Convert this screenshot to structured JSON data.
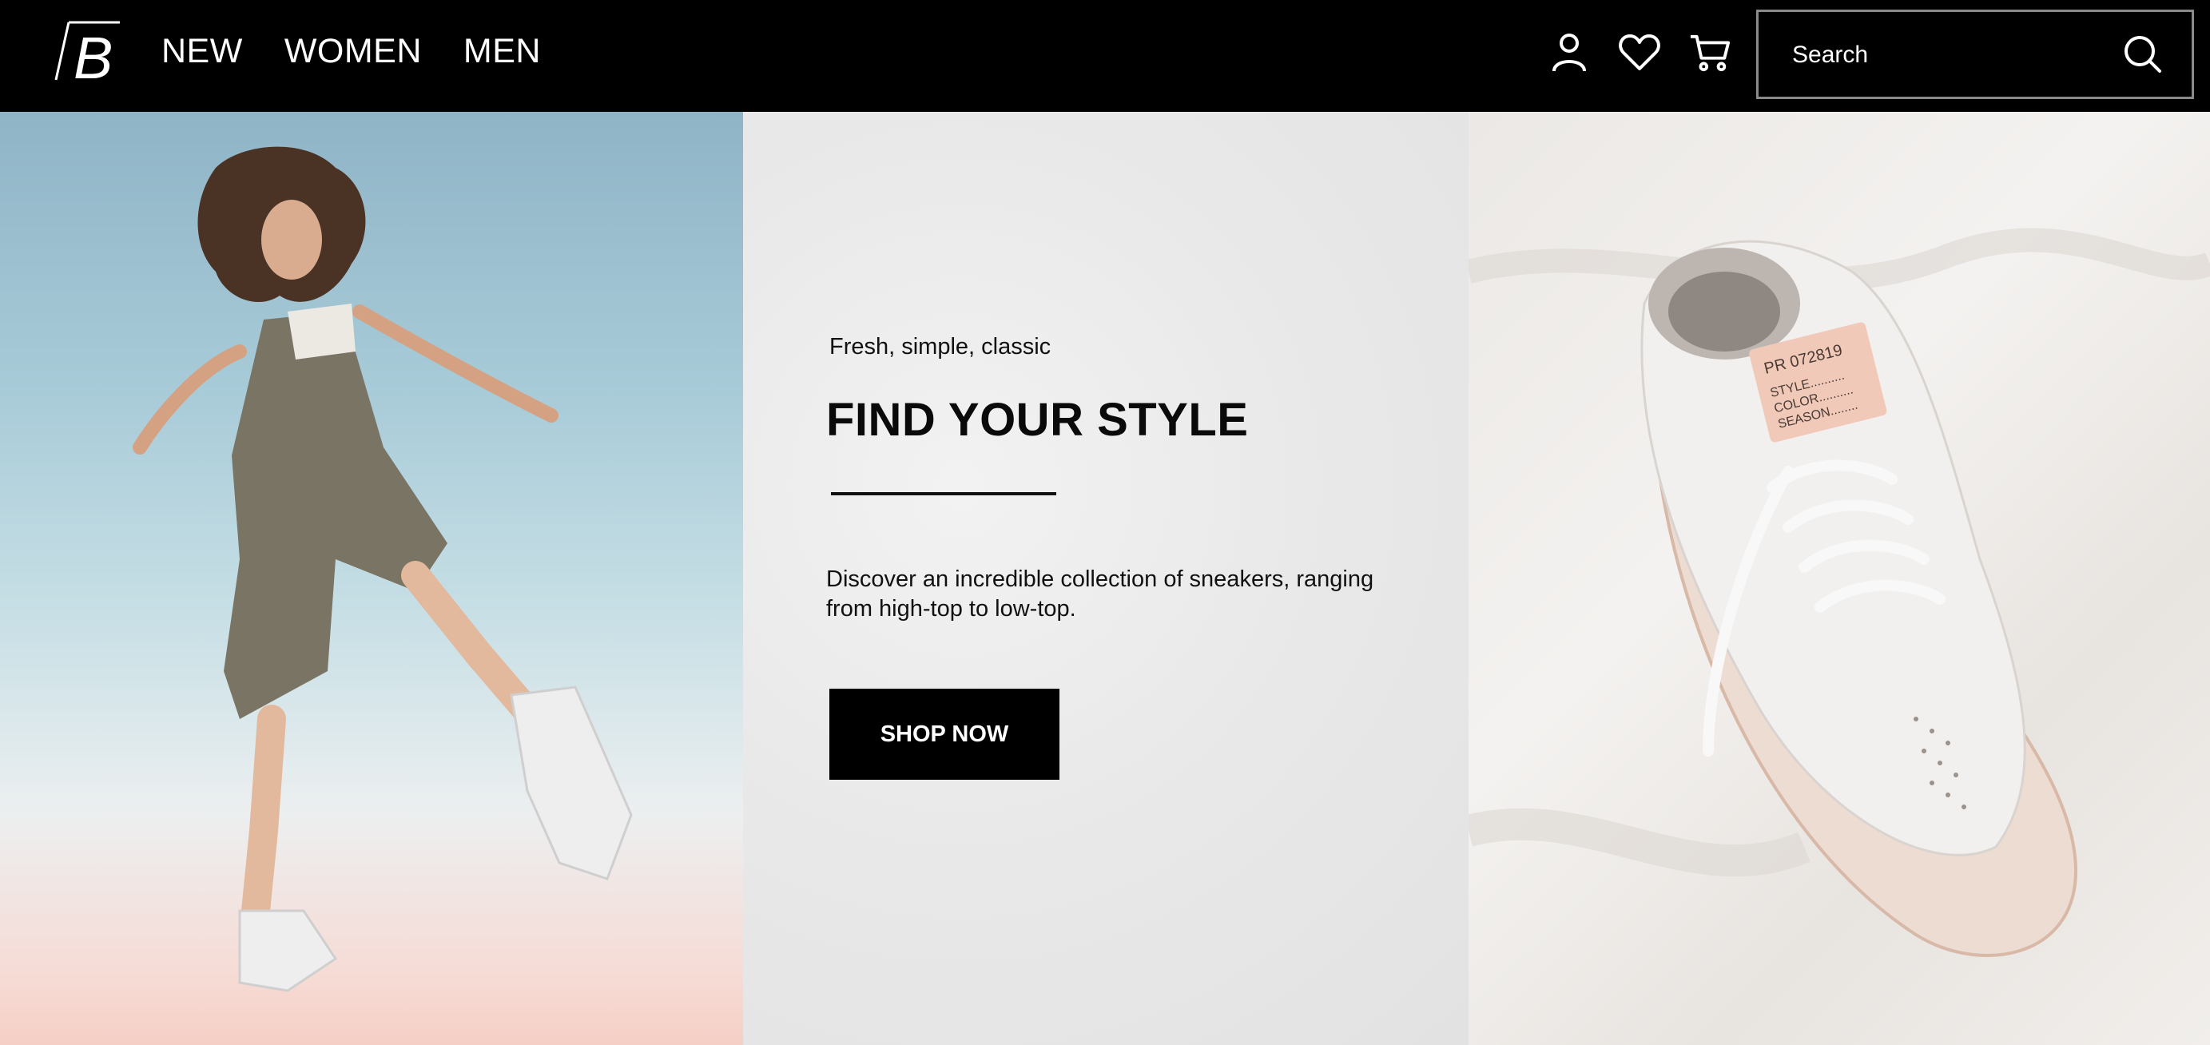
{
  "header": {
    "logo_text": "B",
    "nav": [
      "NEW",
      "WOMEN",
      "MEN"
    ],
    "icons": [
      "user-icon",
      "heart-icon",
      "cart-icon"
    ],
    "search": {
      "placeholder": "Search",
      "value": ""
    }
  },
  "hero": {
    "eyebrow": "Fresh, simple, classic",
    "headline": "FIND YOUR STYLE",
    "description": "Discover an incredible collection of sneakers, ranging from high-top to low-top.",
    "cta_label": "SHOP NOW"
  },
  "shoe_tag": {
    "code": "PR 072819",
    "lines": [
      "STYLE..........",
      "COLOR..........",
      "SEASON........"
    ]
  },
  "colors": {
    "header_bg": "#000000",
    "text_light": "#ffffff",
    "accent": "#000000"
  }
}
